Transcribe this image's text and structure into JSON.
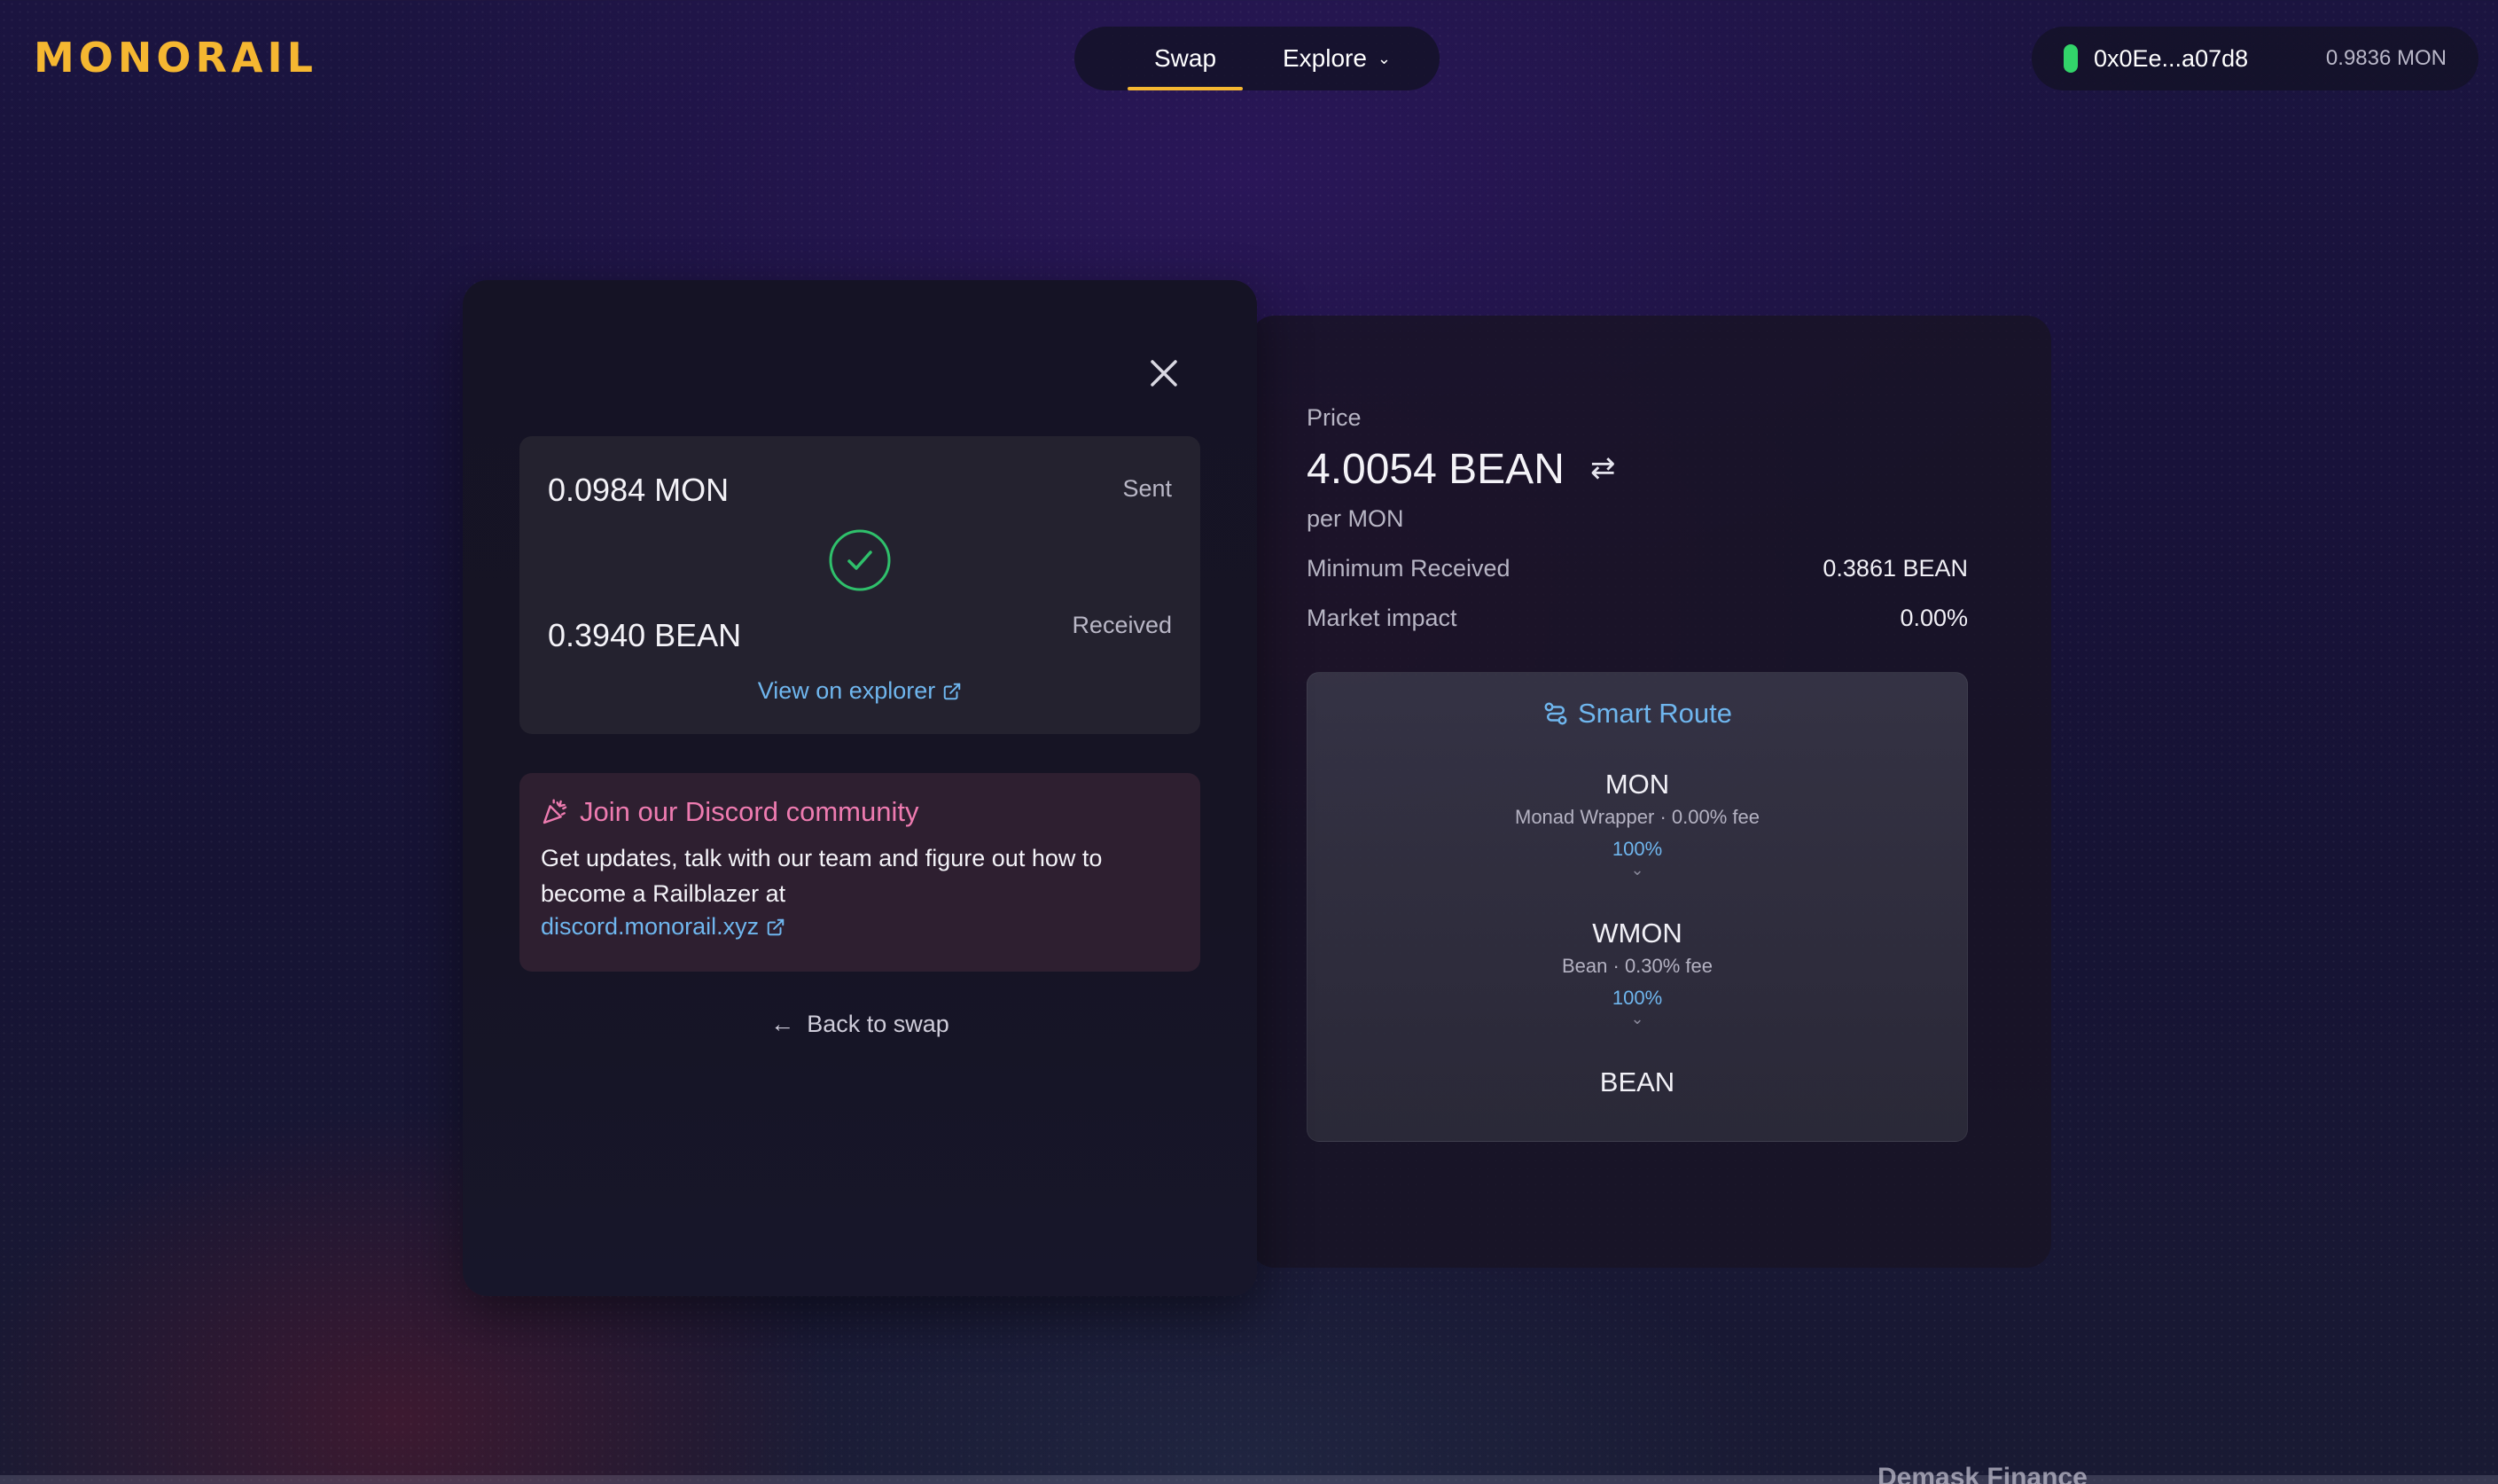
{
  "header": {
    "logo": "MONORAIL",
    "nav": {
      "swap": "Swap",
      "explore": "Explore"
    },
    "wallet": {
      "address": "0x0Ee...a07d8",
      "balance": "0.9836 MON"
    }
  },
  "modal": {
    "sent_amount": "0.0984 MON",
    "sent_label": "Sent",
    "received_amount": "0.3940 BEAN",
    "received_label": "Received",
    "explorer_link": "View on explorer",
    "discord": {
      "title": "Join our Discord community",
      "body": "Get updates, talk with our team and figure out how to become a Railblazer at",
      "link": "discord.monorail.xyz"
    },
    "back_link": "Back to swap"
  },
  "info": {
    "price_label": "Price",
    "price_value": "4.0054 BEAN",
    "price_unit": "per MON",
    "min_received_label": "Minimum Received",
    "min_received_value": "0.3861 BEAN",
    "market_impact_label": "Market impact",
    "market_impact_value": "0.00%",
    "route": {
      "title": "Smart Route",
      "hops": [
        {
          "token": "MON",
          "venue": "Monad Wrapper",
          "fee": "0.00% fee",
          "share": "100%"
        },
        {
          "token": "WMON",
          "venue": "Bean",
          "fee": "0.30% fee",
          "share": "100%"
        },
        {
          "token": "BEAN"
        }
      ]
    }
  },
  "background_peek": "Demask Finance",
  "colors": {
    "accent": "#f5b731",
    "link": "#6fb6ee",
    "success": "#32d46a",
    "discord": "#ee7bb0"
  }
}
